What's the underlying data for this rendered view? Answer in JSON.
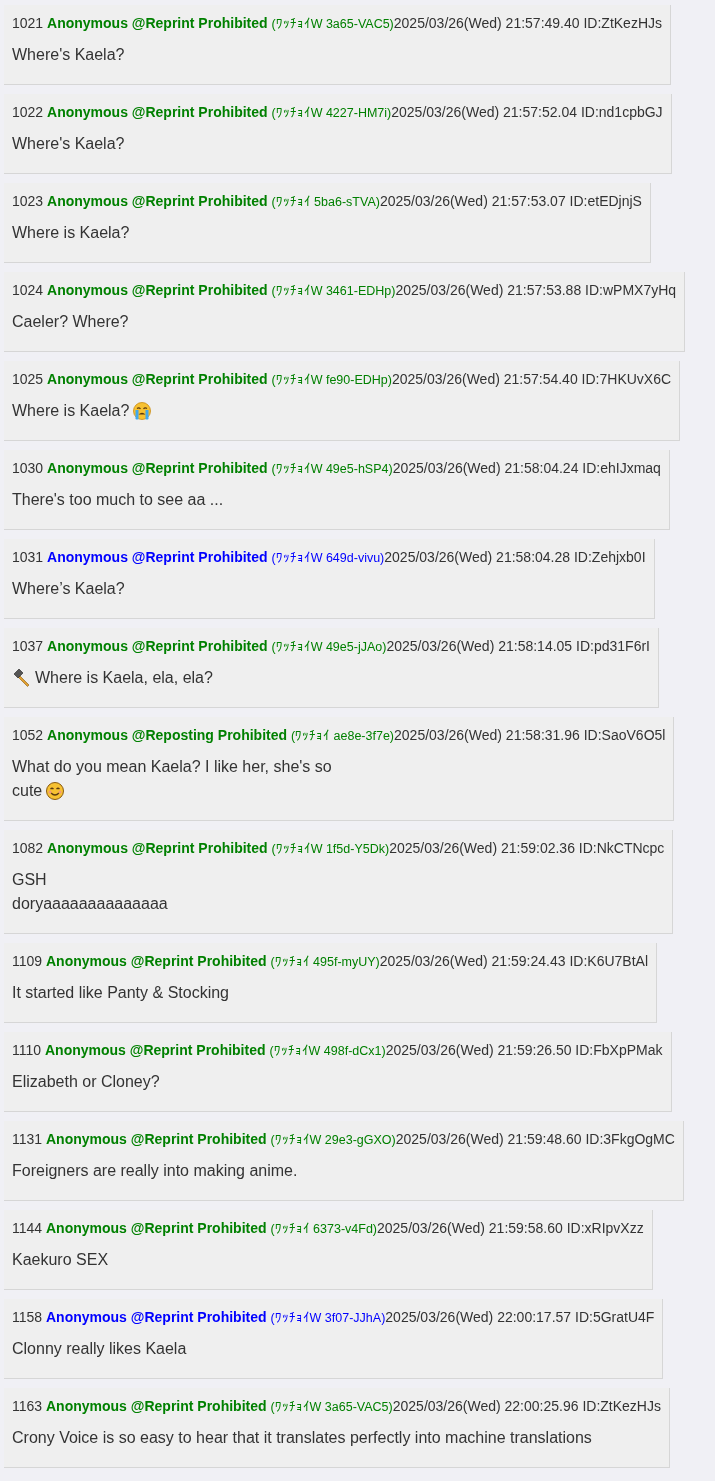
{
  "posts": [
    {
      "number": "1021",
      "name": "Anonymous @Reprint Prohibited",
      "color": "#008000",
      "tag": "(ﾜｯﾁｮｲW 3a65-VAC5)",
      "date": "2025/03/26(Wed) 21:57:49.40",
      "id": "ID:ZtKezHJs",
      "body": [
        [
          {
            "kind": "text",
            "text": "Where's Kaela?"
          }
        ]
      ]
    },
    {
      "number": "1022",
      "name": "Anonymous @Reprint Prohibited",
      "color": "#008000",
      "tag": "(ﾜｯﾁｮｲW 4227-HM7i)",
      "date": "2025/03/26(Wed) 21:57:52.04",
      "id": "ID:nd1cpbGJ",
      "body": [
        [
          {
            "kind": "text",
            "text": "Where's Kaela?"
          }
        ]
      ]
    },
    {
      "number": "1023",
      "name": "Anonymous @Reprint Prohibited",
      "color": "#008000",
      "tag": "(ﾜｯﾁｮｲ 5ba6-sTVA)",
      "date": "2025/03/26(Wed) 21:57:53.07",
      "id": "ID:etEDjnjS",
      "body": [
        [
          {
            "kind": "text",
            "text": "Where is Kaela?"
          }
        ]
      ]
    },
    {
      "number": "1024",
      "name": "Anonymous @Reprint Prohibited",
      "color": "#008000",
      "tag": "(ﾜｯﾁｮｲW 3461-EDHp)",
      "date": "2025/03/26(Wed) 21:57:53.88",
      "id": "ID:wPMX7yHq",
      "body": [
        [
          {
            "kind": "text",
            "text": "Caeler? Where?"
          }
        ]
      ]
    },
    {
      "number": "1025",
      "name": "Anonymous @Reprint Prohibited",
      "color": "#008000",
      "tag": "(ﾜｯﾁｮｲW fe90-EDHp)",
      "date": "2025/03/26(Wed) 21:57:54.40",
      "id": "ID:7HKUvX6C",
      "body": [
        [
          {
            "kind": "text",
            "text": "Where is Kaela?"
          },
          {
            "kind": "crying"
          }
        ]
      ]
    },
    {
      "number": "1030",
      "name": "Anonymous @Reprint Prohibited",
      "color": "#008000",
      "tag": "(ﾜｯﾁｮｲW 49e5-hSP4)",
      "date": "2025/03/26(Wed) 21:58:04.24",
      "id": "ID:ehIJxmaq",
      "body": [
        [
          {
            "kind": "text",
            "text": "There's too much to see aa ..."
          }
        ]
      ]
    },
    {
      "number": "1031",
      "name": "Anonymous @Reprint Prohibited",
      "color": "#0000ff",
      "tag": "(ﾜｯﾁｮｲW 649d-vivu)",
      "date": "2025/03/26(Wed) 21:58:04.28",
      "id": "ID:Zehjxb0I",
      "body": [
        [
          {
            "kind": "text",
            "text": "Where’s Kaela?"
          }
        ]
      ]
    },
    {
      "number": "1037",
      "name": "Anonymous @Reprint Prohibited",
      "color": "#008000",
      "tag": "(ﾜｯﾁｮｲW 49e5-jJAo)",
      "date": "2025/03/26(Wed) 21:58:14.05",
      "id": "ID:pd31F6rI",
      "body": [
        [
          {
            "kind": "hammer"
          },
          {
            "kind": "text",
            "text": "Where is Kaela, ela, ela?"
          }
        ]
      ]
    },
    {
      "number": "1052",
      "name": "Anonymous @Reposting Prohibited",
      "color": "#008000",
      "tag": "(ﾜｯﾁｮｲ ae8e-3f7e)",
      "date": "2025/03/26(Wed) 21:58:31.96",
      "id": "ID:SaoV6O5l",
      "body": [
        [
          {
            "kind": "text",
            "text": "What do you mean Kaela? I like her, she's so"
          }
        ],
        [
          {
            "kind": "text",
            "text": "cute"
          },
          {
            "kind": "smiling"
          }
        ]
      ]
    },
    {
      "number": "1082",
      "name": "Anonymous @Reprint Prohibited",
      "color": "#008000",
      "tag": "(ﾜｯﾁｮｲW 1f5d-Y5Dk)",
      "date": "2025/03/26(Wed) 21:59:02.36",
      "id": "ID:NkCTNcpc",
      "body": [
        [
          {
            "kind": "text",
            "text": "GSH"
          }
        ],
        [
          {
            "kind": "text",
            "text": "doryaaaaaaaaaaaaaa"
          }
        ]
      ]
    },
    {
      "number": "1109",
      "name": "Anonymous @Reprint Prohibited",
      "color": "#008000",
      "tag": "(ﾜｯﾁｮｲ 495f-myUY)",
      "date": "2025/03/26(Wed) 21:59:24.43",
      "id": "ID:K6U7BtAl",
      "body": [
        [
          {
            "kind": "text",
            "text": "It started like Panty & Stocking"
          }
        ]
      ]
    },
    {
      "number": "1110",
      "name": "Anonymous @Reprint Prohibited",
      "color": "#008000",
      "tag": "(ﾜｯﾁｮｲW 498f-dCx1)",
      "date": "2025/03/26(Wed) 21:59:26.50",
      "id": "ID:FbXpPMak",
      "body": [
        [
          {
            "kind": "text",
            "text": "Elizabeth or Cloney?"
          }
        ]
      ]
    },
    {
      "number": "1131",
      "name": "Anonymous @Reprint Prohibited",
      "color": "#008000",
      "tag": "(ﾜｯﾁｮｲW 29e3-gGXO)",
      "date": "2025/03/26(Wed) 21:59:48.60",
      "id": "ID:3FkgOgMC",
      "body": [
        [
          {
            "kind": "text",
            "text": "Foreigners are really into making anime."
          }
        ]
      ]
    },
    {
      "number": "1144",
      "name": "Anonymous @Reprint Prohibited",
      "color": "#008000",
      "tag": "(ﾜｯﾁｮｲ 6373-v4Fd)",
      "date": "2025/03/26(Wed) 21:59:58.60",
      "id": "ID:xRIpvXzz",
      "body": [
        [
          {
            "kind": "text",
            "text": "Kaekuro SEX"
          }
        ]
      ]
    },
    {
      "number": "1158",
      "name": "Anonymous @Reprint Prohibited",
      "color": "#0000ff",
      "tag": "(ﾜｯﾁｮｲW 3f07-JJhA)",
      "date": "2025/03/26(Wed) 22:00:17.57",
      "id": "ID:5GratU4F",
      "body": [
        [
          {
            "kind": "text",
            "text": "Clonny really likes Kaela"
          }
        ]
      ]
    },
    {
      "number": "1163",
      "name": "Anonymous @Reprint Prohibited",
      "color": "#008000",
      "tag": "(ﾜｯﾁｮｲW 3a65-VAC5)",
      "date": "2025/03/26(Wed) 22:00:25.96",
      "id": "ID:ZtKezHJs",
      "body": [
        [
          {
            "kind": "text",
            "text": "Crony Voice is so easy to hear that it translates perfectly into machine translations"
          }
        ]
      ]
    }
  ]
}
